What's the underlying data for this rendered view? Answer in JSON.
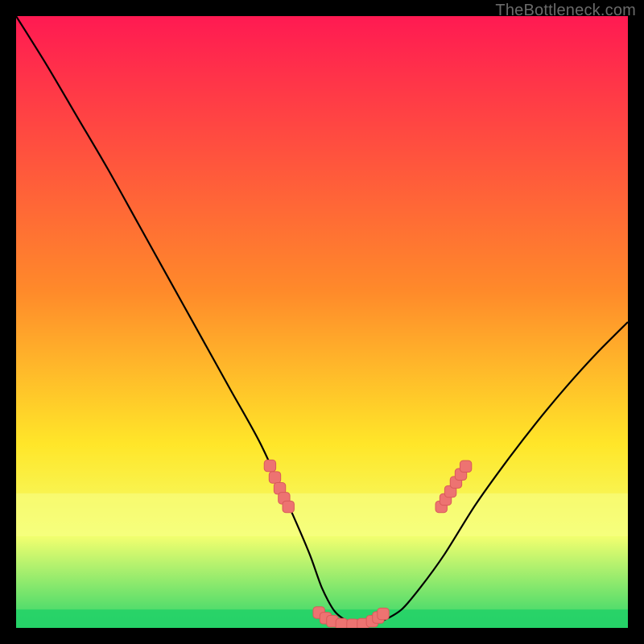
{
  "watermark": "TheBottleneck.com",
  "colors": {
    "bg": "#000000",
    "frame": "#000000",
    "curve": "#000000",
    "marker_fill": "#ed7371",
    "marker_stroke": "#d95a5a",
    "grad_top": "#ff1a52",
    "grad_mid1": "#ff8a2a",
    "grad_mid2": "#ffe629",
    "grad_low": "#f3ff6f",
    "grad_bot": "#2bd46b"
  },
  "chart_data": {
    "type": "line",
    "title": "",
    "xlabel": "",
    "ylabel": "",
    "xlim": [
      0,
      100
    ],
    "ylim": [
      0,
      100
    ],
    "yellow_band_y": [
      15,
      22
    ],
    "green_band_y": [
      0,
      3
    ],
    "series": [
      {
        "name": "bottleneck-curve",
        "x": [
          0,
          5,
          10,
          15,
          20,
          25,
          30,
          35,
          40,
          45,
          48,
          50,
          52,
          54,
          56,
          58,
          60,
          63,
          66,
          70,
          75,
          80,
          85,
          90,
          95,
          100
        ],
        "y": [
          100,
          92,
          83.5,
          75,
          66,
          57,
          48,
          39,
          30,
          19,
          12,
          6.5,
          2.8,
          1.2,
          0.6,
          0.6,
          1.2,
          3.0,
          6.5,
          12,
          20,
          27,
          33.5,
          39.5,
          45,
          50
        ]
      }
    ],
    "markers": [
      {
        "x": 41.5,
        "y": 26.5
      },
      {
        "x": 42.3,
        "y": 24.6
      },
      {
        "x": 43.1,
        "y": 22.8
      },
      {
        "x": 43.8,
        "y": 21.2
      },
      {
        "x": 44.5,
        "y": 19.8
      },
      {
        "x": 49.5,
        "y": 2.5
      },
      {
        "x": 50.6,
        "y": 1.6
      },
      {
        "x": 51.7,
        "y": 1.1
      },
      {
        "x": 53.2,
        "y": 0.6
      },
      {
        "x": 55.0,
        "y": 0.5
      },
      {
        "x": 56.7,
        "y": 0.6
      },
      {
        "x": 58.2,
        "y": 1.1
      },
      {
        "x": 59.2,
        "y": 1.7
      },
      {
        "x": 60.0,
        "y": 2.3
      },
      {
        "x": 69.5,
        "y": 19.8
      },
      {
        "x": 70.2,
        "y": 21.0
      },
      {
        "x": 71.0,
        "y": 22.3
      },
      {
        "x": 71.9,
        "y": 23.8
      },
      {
        "x": 72.7,
        "y": 25.1
      },
      {
        "x": 73.5,
        "y": 26.4
      }
    ]
  }
}
